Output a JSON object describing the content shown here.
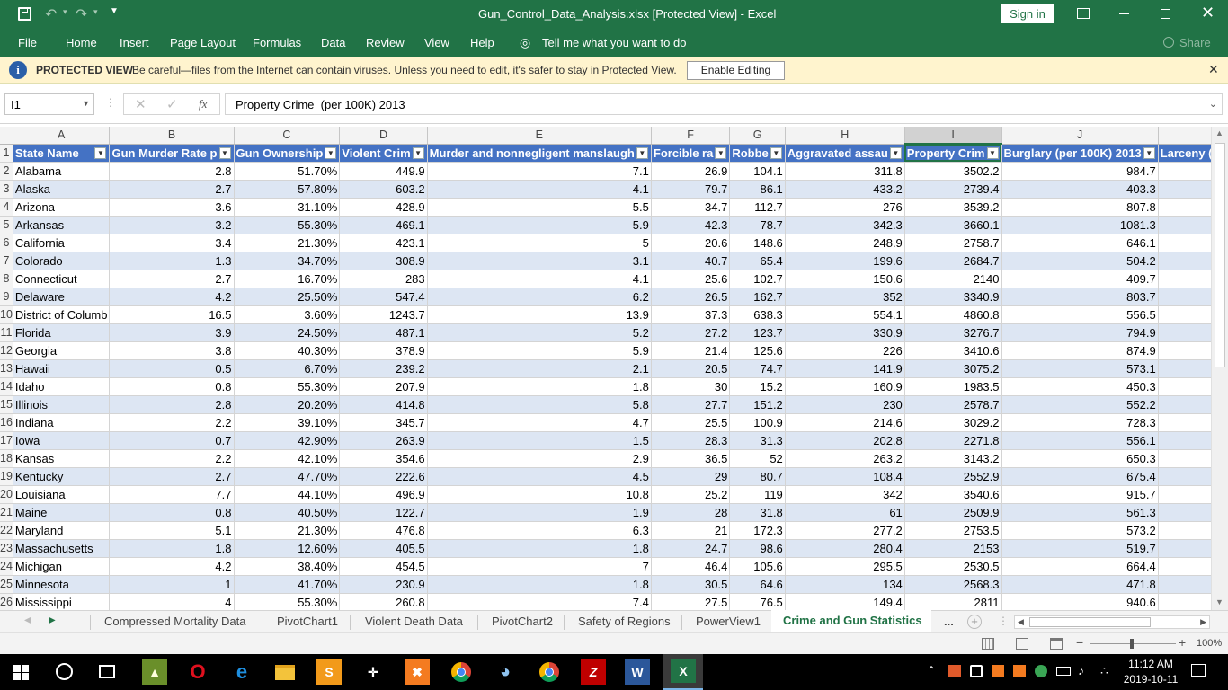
{
  "title_bar": {
    "title": "Gun_Control_Data_Analysis.xlsx  [Protected View]  -  Excel",
    "sign_in": "Sign in"
  },
  "ribbon": {
    "tabs": [
      "File",
      "Home",
      "Insert",
      "Page Layout",
      "Formulas",
      "Data",
      "Review",
      "View",
      "Help"
    ],
    "tell_me": "Tell me what you want to do",
    "share": "Share"
  },
  "protected_view": {
    "label": "PROTECTED VIEW",
    "message": "Be careful—files from the Internet can contain viruses. Unless you need to edit, it's safer to stay in Protected View.",
    "button": "Enable Editing"
  },
  "formula_bar": {
    "name_box": "I1",
    "fx": "fx",
    "content": "Property Crime  (per 100K) 2013"
  },
  "sheet": {
    "columns": [
      "A",
      "B",
      "C",
      "D",
      "E",
      "F",
      "G",
      "H",
      "I",
      "J"
    ],
    "headers": [
      "State Name",
      "Gun Murder Rate p",
      "Gun Ownership",
      "Violent Crim",
      "Murder and nonnegligent manslaugh",
      "Forcible ra",
      "Robbe",
      "Aggravated assau",
      "Property Crim",
      "Burglary  (per 100K) 2013",
      "Larceny (p"
    ],
    "rows": [
      {
        "n": "2",
        "v": [
          "Alabama",
          "2.8",
          "51.70%",
          "449.9",
          "7.1",
          "26.9",
          "104.1",
          "311.8",
          "3502.2",
          "984.7"
        ]
      },
      {
        "n": "3",
        "v": [
          "Alaska",
          "2.7",
          "57.80%",
          "603.2",
          "4.1",
          "79.7",
          "86.1",
          "433.2",
          "2739.4",
          "403.3"
        ]
      },
      {
        "n": "4",
        "v": [
          "Arizona",
          "3.6",
          "31.10%",
          "428.9",
          "5.5",
          "34.7",
          "112.7",
          "276",
          "3539.2",
          "807.8"
        ]
      },
      {
        "n": "5",
        "v": [
          "Arkansas",
          "3.2",
          "55.30%",
          "469.1",
          "5.9",
          "42.3",
          "78.7",
          "342.3",
          "3660.1",
          "1081.3"
        ]
      },
      {
        "n": "6",
        "v": [
          "California",
          "3.4",
          "21.30%",
          "423.1",
          "5",
          "20.6",
          "148.6",
          "248.9",
          "2758.7",
          "646.1"
        ]
      },
      {
        "n": "7",
        "v": [
          "Colorado",
          "1.3",
          "34.70%",
          "308.9",
          "3.1",
          "40.7",
          "65.4",
          "199.6",
          "2684.7",
          "504.2"
        ]
      },
      {
        "n": "8",
        "v": [
          "Connecticut",
          "2.7",
          "16.70%",
          "283",
          "4.1",
          "25.6",
          "102.7",
          "150.6",
          "2140",
          "409.7"
        ]
      },
      {
        "n": "9",
        "v": [
          "Delaware",
          "4.2",
          "25.50%",
          "547.4",
          "6.2",
          "26.5",
          "162.7",
          "352",
          "3340.9",
          "803.7"
        ]
      },
      {
        "n": "10",
        "v": [
          "District of Columb",
          "16.5",
          "3.60%",
          "1243.7",
          "13.9",
          "37.3",
          "638.3",
          "554.1",
          "4860.8",
          "556.5"
        ]
      },
      {
        "n": "11",
        "v": [
          "Florida",
          "3.9",
          "24.50%",
          "487.1",
          "5.2",
          "27.2",
          "123.7",
          "330.9",
          "3276.7",
          "794.9"
        ]
      },
      {
        "n": "12",
        "v": [
          "Georgia",
          "3.8",
          "40.30%",
          "378.9",
          "5.9",
          "21.4",
          "125.6",
          "226",
          "3410.6",
          "874.9"
        ]
      },
      {
        "n": "13",
        "v": [
          "Hawaii",
          "0.5",
          "6.70%",
          "239.2",
          "2.1",
          "20.5",
          "74.7",
          "141.9",
          "3075.2",
          "573.1"
        ]
      },
      {
        "n": "14",
        "v": [
          "Idaho",
          "0.8",
          "55.30%",
          "207.9",
          "1.8",
          "30",
          "15.2",
          "160.9",
          "1983.5",
          "450.3"
        ]
      },
      {
        "n": "15",
        "v": [
          "Illinois",
          "2.8",
          "20.20%",
          "414.8",
          "5.8",
          "27.7",
          "151.2",
          "230",
          "2578.7",
          "552.2"
        ]
      },
      {
        "n": "16",
        "v": [
          "Indiana",
          "2.2",
          "39.10%",
          "345.7",
          "4.7",
          "25.5",
          "100.9",
          "214.6",
          "3029.2",
          "728.3"
        ]
      },
      {
        "n": "17",
        "v": [
          "Iowa",
          "0.7",
          "42.90%",
          "263.9",
          "1.5",
          "28.3",
          "31.3",
          "202.8",
          "2271.8",
          "556.1"
        ]
      },
      {
        "n": "18",
        "v": [
          "Kansas",
          "2.2",
          "42.10%",
          "354.6",
          "2.9",
          "36.5",
          "52",
          "263.2",
          "3143.2",
          "650.3"
        ]
      },
      {
        "n": "19",
        "v": [
          "Kentucky",
          "2.7",
          "47.70%",
          "222.6",
          "4.5",
          "29",
          "80.7",
          "108.4",
          "2552.9",
          "675.4"
        ]
      },
      {
        "n": "20",
        "v": [
          "Louisiana",
          "7.7",
          "44.10%",
          "496.9",
          "10.8",
          "25.2",
          "119",
          "342",
          "3540.6",
          "915.7"
        ]
      },
      {
        "n": "21",
        "v": [
          "Maine",
          "0.8",
          "40.50%",
          "122.7",
          "1.9",
          "28",
          "31.8",
          "61",
          "2509.9",
          "561.3"
        ]
      },
      {
        "n": "22",
        "v": [
          "Maryland",
          "5.1",
          "21.30%",
          "476.8",
          "6.3",
          "21",
          "172.3",
          "277.2",
          "2753.5",
          "573.2"
        ]
      },
      {
        "n": "23",
        "v": [
          "Massachusetts",
          "1.8",
          "12.60%",
          "405.5",
          "1.8",
          "24.7",
          "98.6",
          "280.4",
          "2153",
          "519.7"
        ]
      },
      {
        "n": "24",
        "v": [
          "Michigan",
          "4.2",
          "38.40%",
          "454.5",
          "7",
          "46.4",
          "105.6",
          "295.5",
          "2530.5",
          "664.4"
        ]
      },
      {
        "n": "25",
        "v": [
          "Minnesota",
          "1",
          "41.70%",
          "230.9",
          "1.8",
          "30.5",
          "64.6",
          "134",
          "2568.3",
          "471.8"
        ]
      },
      {
        "n": "26",
        "v": [
          "Mississippi",
          "4",
          "55.30%",
          "260.8",
          "7.4",
          "27.5",
          "76.5",
          "149.4",
          "2811",
          "940.6"
        ]
      }
    ]
  },
  "sheet_tabs": [
    "Compressed Mortality Data",
    "PivotChart1",
    "Violent Death Data",
    "PivotChart2",
    "Safety of Regions",
    "PowerView1",
    "Crime and Gun Statistics"
  ],
  "active_sheet": "Crime and Gun Statistics",
  "sheet_more": "...",
  "status": {
    "zoom": "100%"
  },
  "taskbar": {
    "time": "11:12 AM",
    "date": "2019-10-11"
  },
  "colors": {
    "excel_green": "#217346",
    "table_header": "#4472c4",
    "band": "#dde6f3",
    "pv_bar": "#fff4ce"
  }
}
